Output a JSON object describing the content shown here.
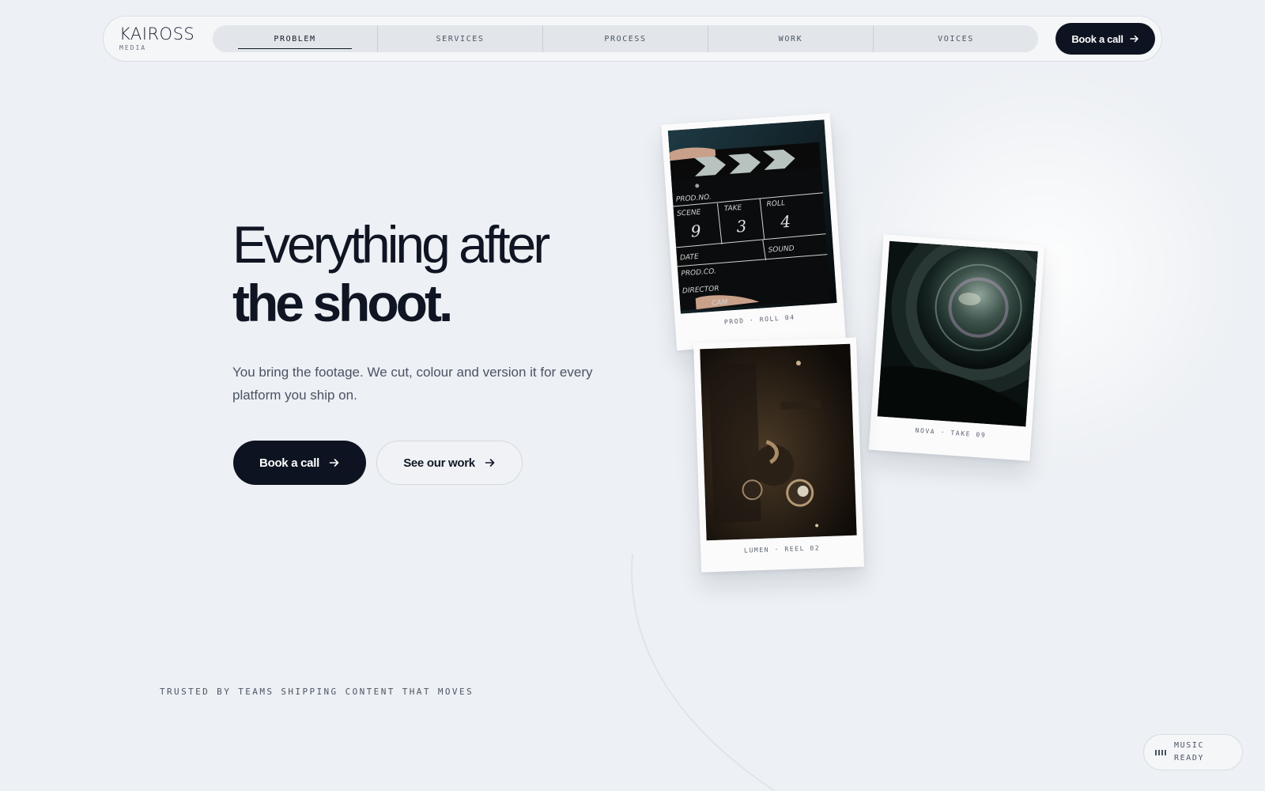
{
  "brand": {
    "name": "KAIROSS",
    "sub": "MEDIA"
  },
  "nav": {
    "tabs": [
      {
        "label": "PROBLEM",
        "active": true
      },
      {
        "label": "SERVICES",
        "active": false
      },
      {
        "label": "PROCESS",
        "active": false
      },
      {
        "label": "WORK",
        "active": false
      },
      {
        "label": "VOICES",
        "active": false
      }
    ],
    "cta_label": "Book a call"
  },
  "hero": {
    "title_line1": "Everything after",
    "title_line2": "the shoot.",
    "subtitle": "You bring the footage. We cut, colour and version it for every platform you ship on.",
    "primary_label": "Book a call",
    "secondary_label": "See our work"
  },
  "polaroids": [
    {
      "caption": "PROD · ROLL 04",
      "subject": "film clapperboard"
    },
    {
      "caption": "LUMEN · REEL 02",
      "subject": "film projector"
    },
    {
      "caption": "NOVA · TAKE 09",
      "subject": "camera lens"
    }
  ],
  "clapperboard": {
    "prod": "PROD.NO.",
    "scene": "SCENE",
    "scene_value": "9",
    "take": "TAKE",
    "take_value": "3",
    "roll": "ROLL",
    "roll_value": "4",
    "date": "DATE",
    "sound": "SOUND",
    "prod_co": "PROD.CO.",
    "director": "DIRECTOR",
    "camera": "CAM"
  },
  "trusted": "TRUSTED BY TEAMS SHIPPING CONTENT THAT MOVES",
  "music": {
    "label": "MUSIC READY"
  },
  "colors": {
    "background": "#edf0f4",
    "ink": "#0d1320",
    "muted": "#4b5563"
  }
}
